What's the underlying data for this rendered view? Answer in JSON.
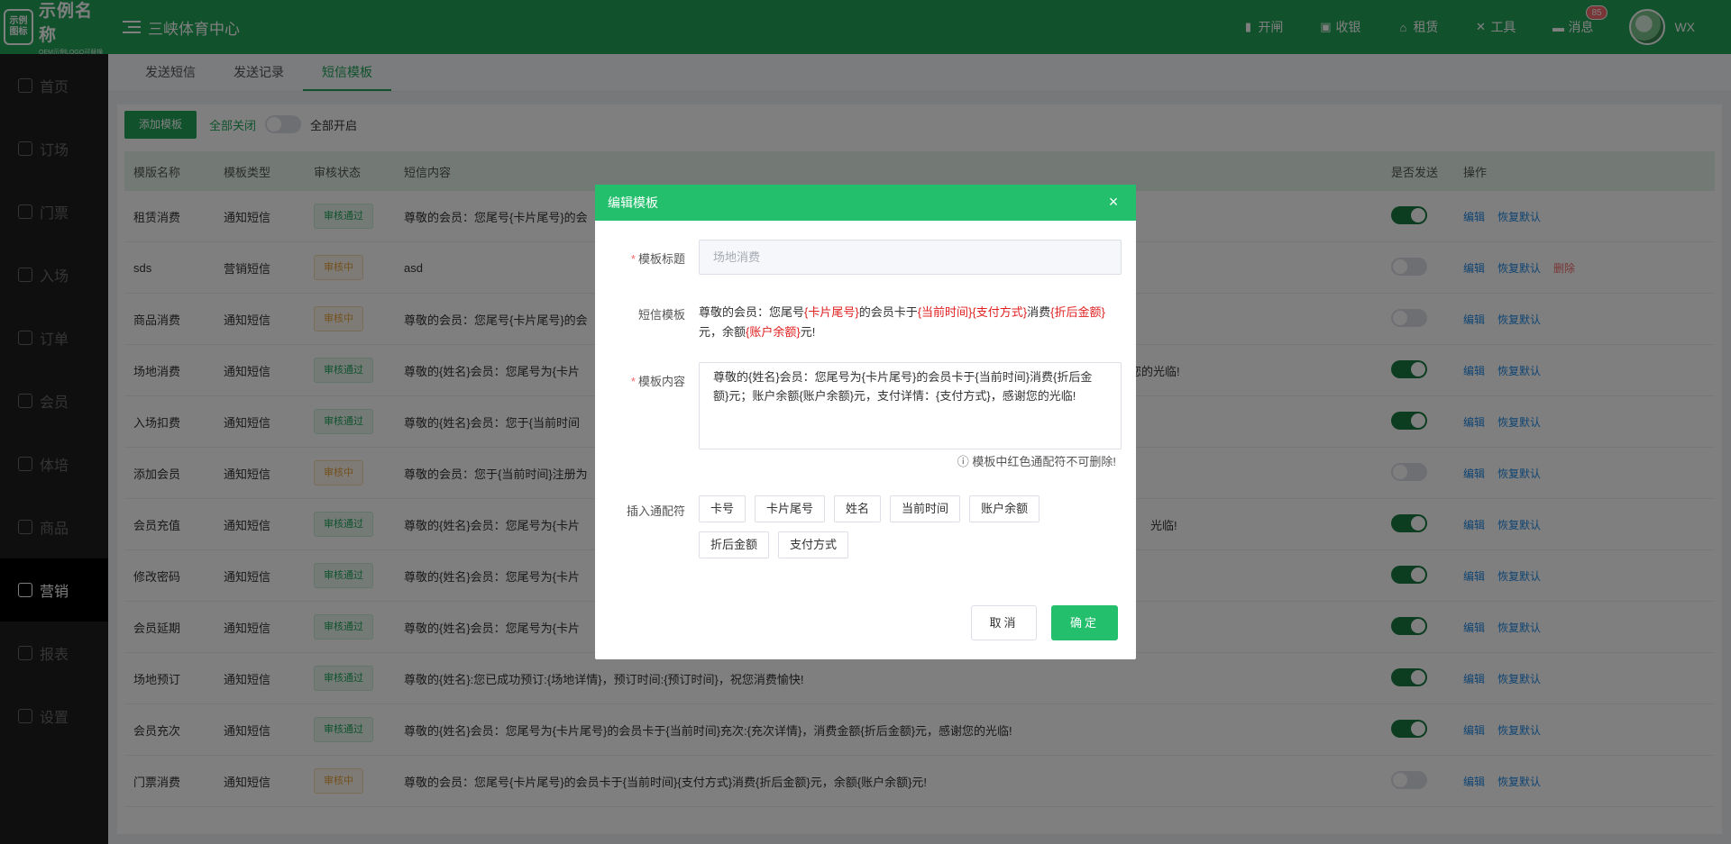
{
  "header": {
    "logo_box": "示例\n图标",
    "logo_name": "示例名称",
    "logo_sub": "OEM示例LOGO可替换",
    "venue": "三峡体育中心",
    "tools": [
      {
        "label": "开闸",
        "icon": "gate-icon"
      },
      {
        "label": "收银",
        "icon": "cashier-icon"
      },
      {
        "label": "租赁",
        "icon": "home-icon"
      },
      {
        "label": "工具",
        "icon": "tools-icon"
      },
      {
        "label": "消息",
        "icon": "message-icon",
        "badge": "85"
      }
    ],
    "user": "WX"
  },
  "sidebar": {
    "items": [
      {
        "label": "首页"
      },
      {
        "label": "订场"
      },
      {
        "label": "门票"
      },
      {
        "label": "入场"
      },
      {
        "label": "订单"
      },
      {
        "label": "会员"
      },
      {
        "label": "体培"
      },
      {
        "label": "商品"
      },
      {
        "label": "营销",
        "active": true
      },
      {
        "label": "报表"
      },
      {
        "label": "设置"
      }
    ]
  },
  "tabs": [
    {
      "label": "发送短信"
    },
    {
      "label": "发送记录"
    },
    {
      "label": "短信模板",
      "active": true
    }
  ],
  "toolbar": {
    "add_label": "添加模板",
    "all_off": "全部关闭",
    "all_on": "全部开启"
  },
  "table": {
    "headers": {
      "name": "模版名称",
      "type": "模板类型",
      "status": "审核状态",
      "content": "短信内容",
      "send": "是否发送",
      "ops": "操作"
    },
    "rows": [
      {
        "name": "租赁消费",
        "type": "通知短信",
        "status": "审核通过",
        "content": "尊敬的会员：您尾号{卡片尾号}的会",
        "send": true,
        "del": false
      },
      {
        "name": "sds",
        "type": "营销短信",
        "status": "审核中",
        "content": "asd",
        "send": false,
        "del": true
      },
      {
        "name": "商品消费",
        "type": "通知短信",
        "status": "审核中",
        "content": "尊敬的会员：您尾号{卡片尾号}的会",
        "send": false,
        "del": false
      },
      {
        "name": "场地消费",
        "type": "通知短信",
        "status": "审核通过",
        "content": "尊敬的{姓名}会员：您尾号为{卡片",
        "tail": "谢您的光临!",
        "send": true,
        "del": false
      },
      {
        "name": "入场扣费",
        "type": "通知短信",
        "status": "审核通过",
        "content": "尊敬的{姓名}会员：您于{当前时间",
        "send": true,
        "del": false
      },
      {
        "name": "添加会员",
        "type": "通知短信",
        "status": "审核中",
        "content": "尊敬的会员：您于{当前时间}注册为",
        "send": false,
        "del": false
      },
      {
        "name": "会员充值",
        "type": "通知短信",
        "status": "审核通过",
        "content": "尊敬的{姓名}会员：您尾号为{卡片",
        "tail": "光临!",
        "send": true,
        "del": false
      },
      {
        "name": "修改密码",
        "type": "通知短信",
        "status": "审核通过",
        "content": "尊敬的{姓名}会员：您尾号为{卡片",
        "send": true,
        "del": false
      },
      {
        "name": "会员延期",
        "type": "通知短信",
        "status": "审核通过",
        "content": "尊敬的{姓名}会员：您尾号为{卡片",
        "send": true,
        "del": false
      },
      {
        "name": "场地预订",
        "type": "通知短信",
        "status": "审核通过",
        "content": "尊敬的{姓名}:您已成功预订:{场地详情}，预订时间:{预订时间}，祝您消费愉快!",
        "send": true,
        "del": false
      },
      {
        "name": "会员充次",
        "type": "通知短信",
        "status": "审核通过",
        "content": "尊敬的{姓名}会员：您尾号为{卡片尾号}的会员卡于{当前时间}充次:{充次详情}，消费金额{折后金额}元，感谢您的光临!",
        "send": true,
        "del": false
      },
      {
        "name": "门票消费",
        "type": "通知短信",
        "status": "审核中",
        "content": "尊敬的会员：您尾号{卡片尾号}的会员卡于{当前时间}{支付方式}消费{折后金额}元，余额{账户余额}元!",
        "send": false,
        "del": false
      }
    ],
    "op_edit": "编辑",
    "op_reset": "恢复默认",
    "op_delete": "删除"
  },
  "dialog": {
    "title": "编辑模板",
    "title_label": "模板标题",
    "title_placeholder": "场地消费",
    "sms_tpl_label": "短信模板",
    "sms_tpl_parts": [
      {
        "t": "尊敬的会员：您尾号",
        "red": false
      },
      {
        "t": "{卡片尾号}",
        "red": true
      },
      {
        "t": "的会员卡于",
        "red": false
      },
      {
        "t": "{当前时间}{支付方式}",
        "red": true
      },
      {
        "t": "消费",
        "red": false
      },
      {
        "t": "{折后金额}",
        "red": true
      },
      {
        "t": "元，余额",
        "red": false
      },
      {
        "t": "{账户余额}",
        "red": true
      },
      {
        "t": "元!",
        "red": false
      }
    ],
    "content_label": "模板内容",
    "content_value": "尊敬的{姓名}会员：您尾号为{卡片尾号}的会员卡于{当前时间}消费{折后金额}元；账户余额{账户余额}元，支付详情：{支付方式}，感谢您的光临!",
    "hint": "模板中红色通配符不可删除!",
    "insert_label": "插入通配符",
    "chips": [
      "卡号",
      "卡片尾号",
      "姓名",
      "当前时间",
      "账户余额",
      "折后金额",
      "支付方式"
    ],
    "cancel": "取消",
    "ok": "确定"
  }
}
